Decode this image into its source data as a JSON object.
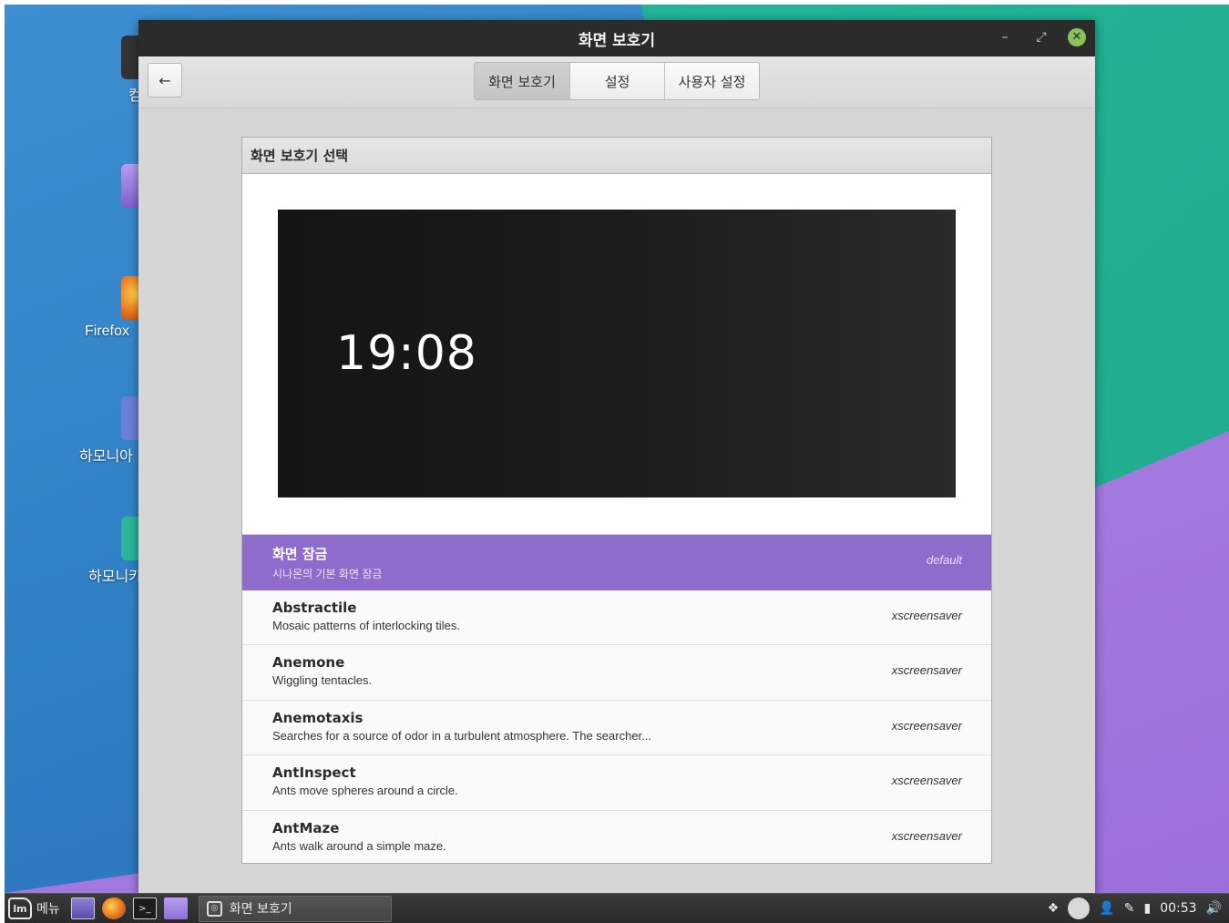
{
  "desktop": {
    "icons": [
      {
        "label": "컴"
      },
      {
        "label": ""
      },
      {
        "label": "Firefox"
      },
      {
        "label": "하모니아"
      },
      {
        "label": "하모니카"
      }
    ]
  },
  "window": {
    "title": "화면 보호기",
    "controls": {
      "minimize": "–",
      "restore": "⤢",
      "close": "✕"
    }
  },
  "toolbar": {
    "back_icon": "←",
    "tabs": [
      {
        "label": "화면 보호기",
        "active": true
      },
      {
        "label": "설정",
        "active": false
      },
      {
        "label": "사용자 설정",
        "active": false
      }
    ]
  },
  "panel": {
    "header": "화면 보호기 선택",
    "preview_clock": "19:08"
  },
  "screensavers": [
    {
      "name": "화면 잠금",
      "desc": "시나몬의 기본 화면 잠금",
      "kind": "default",
      "selected": true
    },
    {
      "name": "Abstractile",
      "desc": "Mosaic patterns of interlocking tiles.",
      "kind": "xscreensaver",
      "selected": false
    },
    {
      "name": "Anemone",
      "desc": "Wiggling tentacles.",
      "kind": "xscreensaver",
      "selected": false
    },
    {
      "name": "Anemotaxis",
      "desc": "Searches for a source of odor in a turbulent atmosphere.  The searcher...",
      "kind": "xscreensaver",
      "selected": false
    },
    {
      "name": "AntInspect",
      "desc": "Ants move spheres around a circle.",
      "kind": "xscreensaver",
      "selected": false
    },
    {
      "name": "AntMaze",
      "desc": "Ants walk around a simple maze.",
      "kind": "xscreensaver",
      "selected": false
    }
  ],
  "taskbar": {
    "menu_label": "메뉴",
    "mint_logo": "lm",
    "terminal_glyph": ">_",
    "task_label": "화면 보호기",
    "tray": {
      "dropbox": "❖",
      "user": "👤",
      "pen": "✎",
      "battery": "▮",
      "clock": "00:53",
      "volume": "🔊"
    }
  },
  "colors": {
    "selected_row": "#8e6ccc",
    "titlebar": "#2b2b2b",
    "close_button": "#8ac25a"
  }
}
